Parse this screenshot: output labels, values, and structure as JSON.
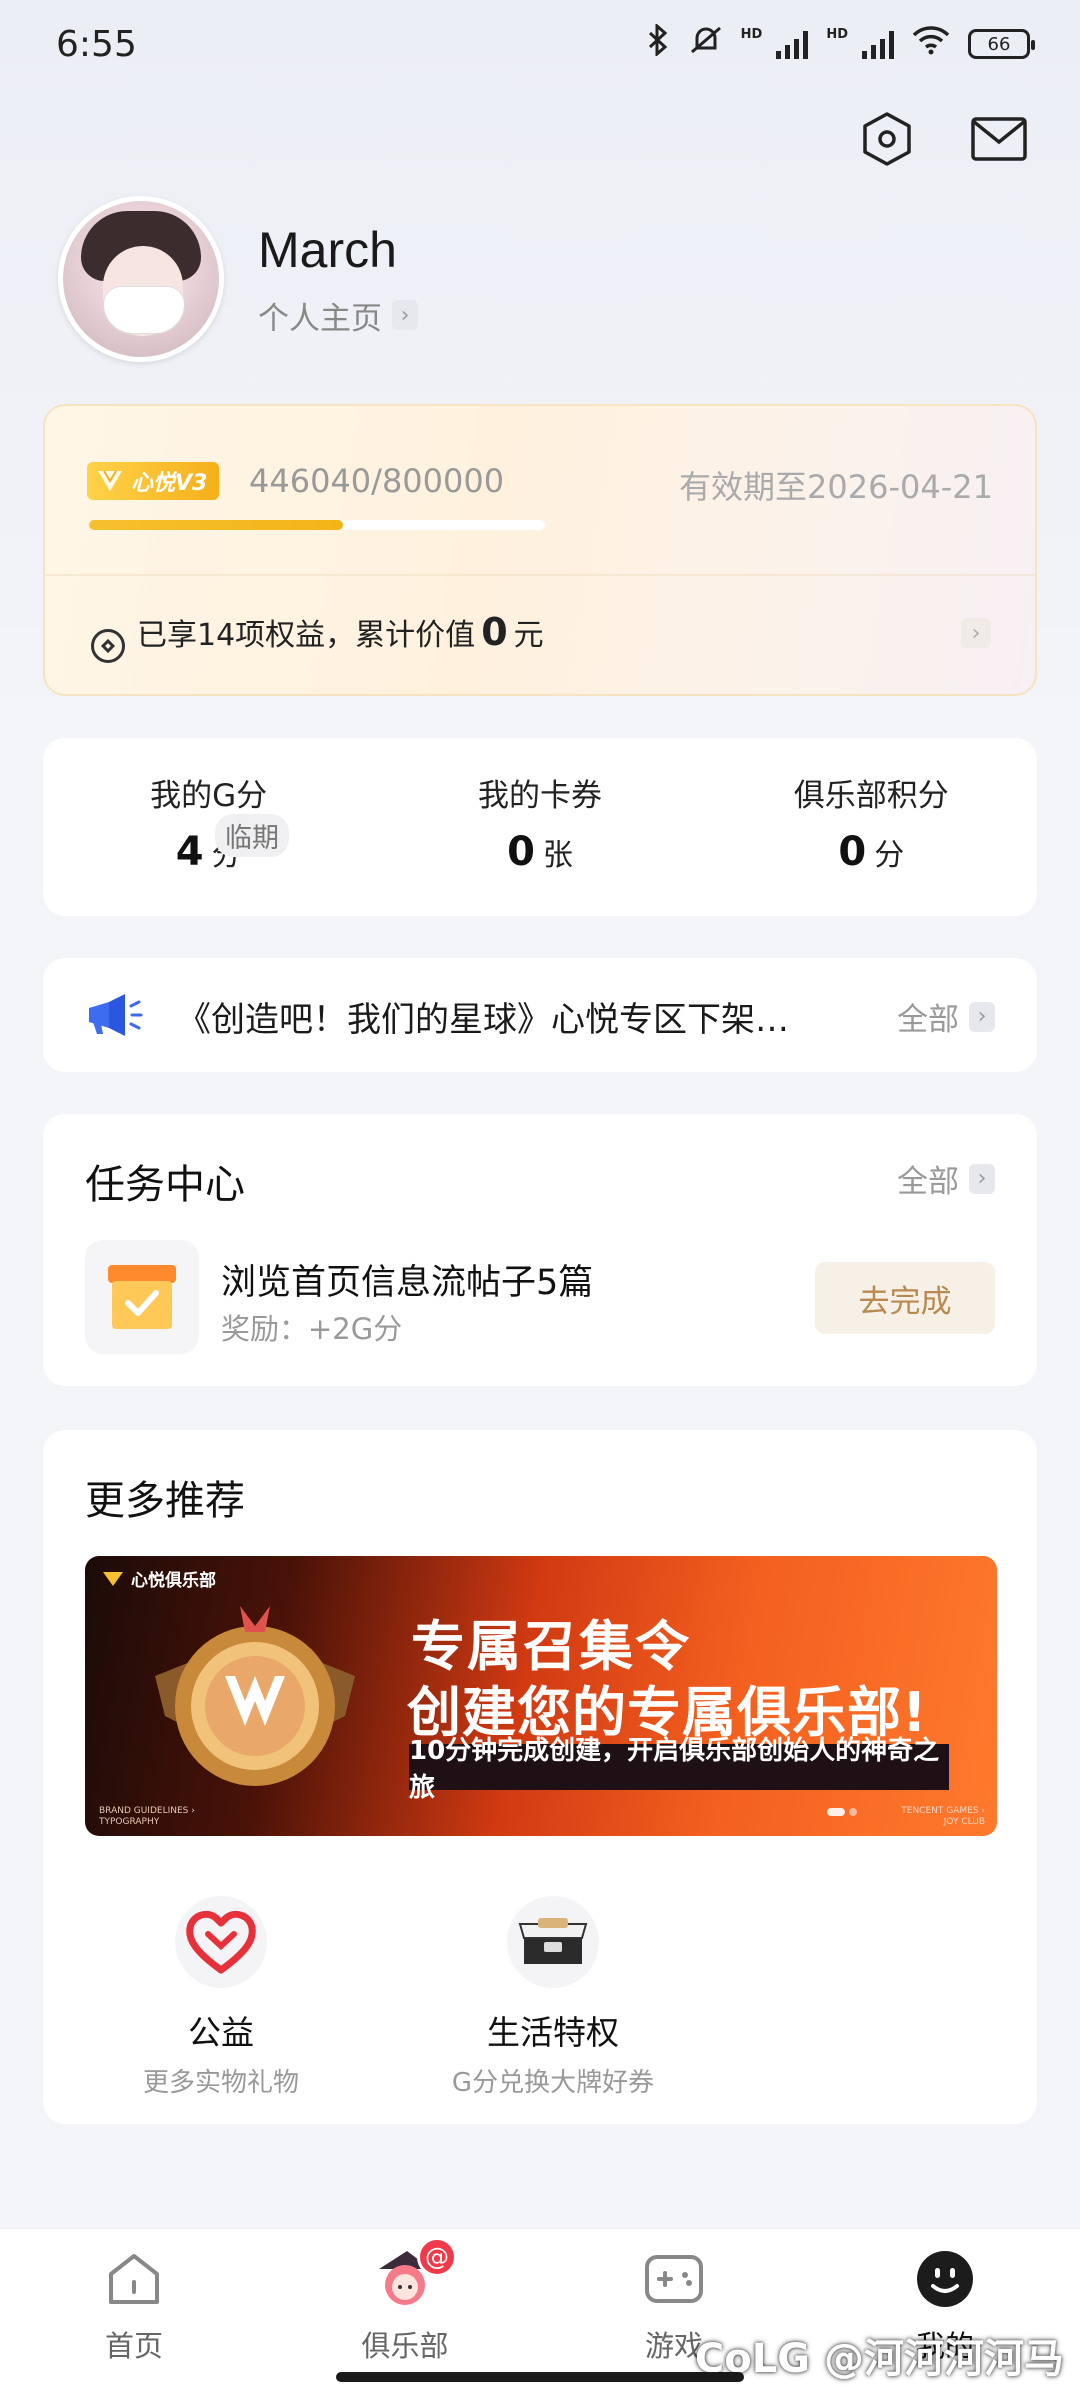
{
  "status_bar": {
    "time": "6:55",
    "battery": "66",
    "hd1": "HD",
    "hd2": "HD"
  },
  "profile": {
    "name": "March",
    "homepage_link": "个人主页",
    "chevron": "›"
  },
  "vip": {
    "badge_text": "心悦V3",
    "points": "446040/800000",
    "progress_fraction": 0.558,
    "expire": "有效期至2026-04-21",
    "benefit_prefix": "已享14项权益，累计价值",
    "benefit_value": "0",
    "benefit_unit": "元"
  },
  "stats": [
    {
      "label": "我的G分",
      "value": "4",
      "unit": "分",
      "tag": "临期"
    },
    {
      "label": "我的卡券",
      "value": "0",
      "unit": "张"
    },
    {
      "label": "俱乐部积分",
      "value": "0",
      "unit": "分"
    }
  ],
  "notice": {
    "text": "《创造吧！我们的星球》心悦专区下架…",
    "all_label": "全部"
  },
  "task_center": {
    "title": "任务中心",
    "all_label": "全部",
    "task": {
      "name": "浏览首页信息流帖子5篇",
      "reward": "奖励：+2G分",
      "button": "去完成"
    }
  },
  "more": {
    "title": "更多推荐",
    "banner": {
      "logo": "心悦俱乐部",
      "line1": "专属召集令",
      "line2": "创建您的专属俱乐部!",
      "strip": "10分钟完成创建，开启俱乐部创始人的神奇之旅",
      "small_left": "BRAND GUIDELINES ›\nTYPOGRAPHY",
      "small_right": "TENCENT GAMES ›\nJOY CLUB"
    },
    "items": [
      {
        "title": "公益",
        "sub": "更多实物礼物",
        "icon": "heart-icon"
      },
      {
        "title": "生活特权",
        "sub": "G分兑换大牌好券",
        "icon": "gift-box-icon"
      }
    ]
  },
  "tabbar": [
    {
      "label": "首页",
      "icon": "home-icon"
    },
    {
      "label": "俱乐部",
      "icon": "club-avatar-icon",
      "badge": "@"
    },
    {
      "label": "游戏",
      "icon": "gamepad-icon"
    },
    {
      "label": "我的",
      "icon": "me-icon",
      "active": true
    }
  ],
  "watermark": "CoLG @河河河河马"
}
